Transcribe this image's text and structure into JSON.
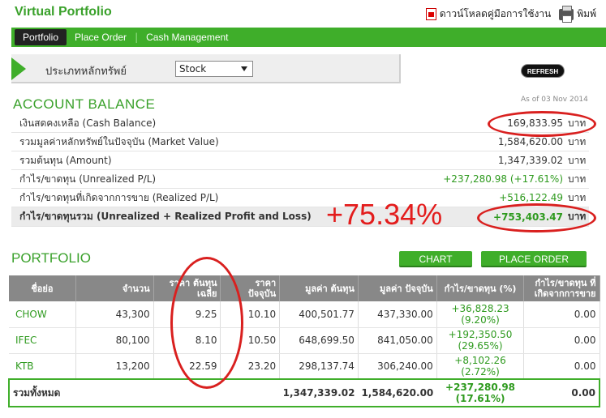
{
  "header": {
    "title": "Virtual Portfolio",
    "download_label": "ดาวน์โหลดคู่มือการใช้งาน",
    "print_label": "พิมพ์"
  },
  "nav": {
    "tabs": [
      {
        "label": "Portfolio",
        "active": true
      },
      {
        "label": "Place Order",
        "active": false
      },
      {
        "label": "Cash Management",
        "active": false
      }
    ]
  },
  "filter": {
    "label": "ประเภทหลักทรัพย์",
    "selected": "Stock"
  },
  "refresh_label": "REFRESH",
  "account": {
    "title": "ACCOUNT BALANCE",
    "as_of": "As of 03 Nov 2014",
    "unit": "บาท",
    "rows": [
      {
        "label": "เงินสดคงเหลือ (Cash Balance)",
        "value": "169,833.95"
      },
      {
        "label": "รวมมูลค่าหลักทรัพย์ในปัจจุบัน (Market Value)",
        "value": "1,584,620.00"
      },
      {
        "label": "รวมต้นทุน (Amount)",
        "value": "1,347,339.02"
      },
      {
        "label": "กำไร/ขาดทุน (Unrealized P/L)",
        "value": "+237,280.98 (+17.61%)"
      },
      {
        "label": "กำไร/ขาดทุนที่เกิดจากการขาย (Realized P/L)",
        "value": "+516,122.49"
      },
      {
        "label": "กำไร/ขาดทุนรวม (Unrealized + Realized Profit and Loss)",
        "value": "+753,403.47"
      }
    ],
    "annotation_percent": "+75.34%"
  },
  "portfolio": {
    "title": "PORTFOLIO",
    "chart_button": "CHART",
    "place_order_button": "PLACE ORDER",
    "columns": [
      "ชื่อย่อ",
      "จำนวน",
      "ราคา ต้นทุนเฉลี่ย",
      "ราคา ปัจจุบัน",
      "มูลค่า ต้นทุน",
      "มูลค่า ปัจจุบัน",
      "กำไร/ขาดทุน (%)",
      "กำไร/ขาดทุน ที่ เกิดจากการขาย"
    ],
    "rows": [
      {
        "symbol": "CHOW",
        "qty": "43,300",
        "avg_cost": "9.25",
        "price": "10.10",
        "cost_value": "400,501.77",
        "market_value": "437,330.00",
        "pl": "+36,828.23",
        "pl_pct": "(9.20%)",
        "realized": "0.00"
      },
      {
        "symbol": "IFEC",
        "qty": "80,100",
        "avg_cost": "8.10",
        "price": "10.50",
        "cost_value": "648,699.50",
        "market_value": "841,050.00",
        "pl": "+192,350.50",
        "pl_pct": "(29.65%)",
        "realized": "0.00"
      },
      {
        "symbol": "KTB",
        "qty": "13,200",
        "avg_cost": "22.59",
        "price": "23.20",
        "cost_value": "298,137.74",
        "market_value": "306,240.00",
        "pl": "+8,102.26",
        "pl_pct": "(2.72%)",
        "realized": "0.00"
      }
    ],
    "total": {
      "label": "รวมทั้งหมด",
      "cost_value": "1,347,339.02",
      "market_value": "1,584,620.00",
      "pl": "+237,280.98",
      "pl_pct": "(17.61%)",
      "realized": "0.00"
    }
  },
  "colors": {
    "brand_green": "#3fae2a",
    "annotation_red": "#e31c1c"
  }
}
